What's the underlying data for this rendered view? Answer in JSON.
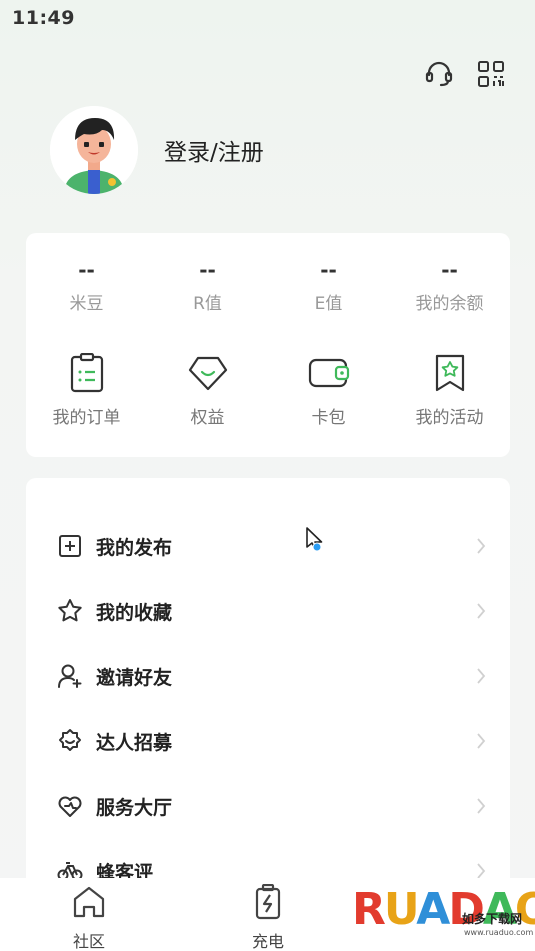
{
  "status_bar": {
    "time": "11:49"
  },
  "header": {
    "icons": [
      {
        "name": "customer-service-icon"
      },
      {
        "name": "qr-scan-icon"
      }
    ]
  },
  "profile": {
    "login_label": "登录/注册",
    "avatar_icon": "avatar-boy"
  },
  "stats": [
    {
      "value": "--",
      "label": "米豆"
    },
    {
      "value": "--",
      "label": "R值"
    },
    {
      "value": "--",
      "label": "E值"
    },
    {
      "value": "--",
      "label": "我的余额"
    }
  ],
  "quick_links": [
    {
      "label": "我的订单",
      "icon": "order-list-icon"
    },
    {
      "label": "权益",
      "icon": "diamond-icon"
    },
    {
      "label": "卡包",
      "icon": "wallet-icon"
    },
    {
      "label": "我的活动",
      "icon": "bookmark-star-icon"
    }
  ],
  "menu": [
    {
      "label": "我的发布",
      "icon": "add-square-icon"
    },
    {
      "label": "我的收藏",
      "icon": "star-icon"
    },
    {
      "label": "邀请好友",
      "icon": "user-add-icon"
    },
    {
      "label": "达人招募",
      "icon": "badge-icon"
    },
    {
      "label": "服务大厅",
      "icon": "heart-icon"
    },
    {
      "label": "蜂客评",
      "icon": "bike-icon"
    }
  ],
  "tabbar": [
    {
      "label": "社区",
      "icon": "home-icon"
    },
    {
      "label": "充电",
      "icon": "charge-icon"
    }
  ],
  "watermark": {
    "letters": "RUADADO",
    "sub": "如多下载网",
    "url": "www.ruaduo.com"
  },
  "colors": {
    "accent": "#3fb95a",
    "text": "#222222",
    "muted": "#999999"
  }
}
